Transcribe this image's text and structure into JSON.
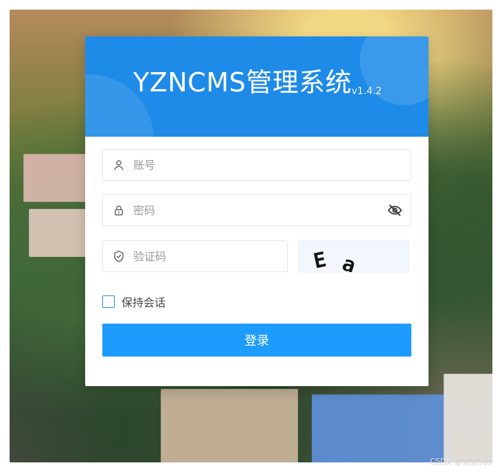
{
  "header": {
    "title": "YZNCMS管理系统",
    "version": "v1.4.2"
  },
  "form": {
    "account": {
      "placeholder": "账号",
      "value": ""
    },
    "password": {
      "placeholder": "密码",
      "value": ""
    },
    "captcha": {
      "placeholder": "验证码",
      "value": "",
      "image_text": [
        "E",
        "a"
      ]
    },
    "remember": {
      "label": "保持会话",
      "checked": false
    },
    "submit": {
      "label": "登录"
    }
  },
  "watermark": {
    "text": "CSDN @青茶360"
  },
  "colors": {
    "header_bg": "#1f8be8",
    "button_bg": "#1e9bff",
    "checkbox_border": "#1f8be8"
  },
  "icons": {
    "account": "user-icon",
    "password": "lock-icon",
    "captcha": "shield-check-icon",
    "toggle_password": "eye-off-icon"
  }
}
